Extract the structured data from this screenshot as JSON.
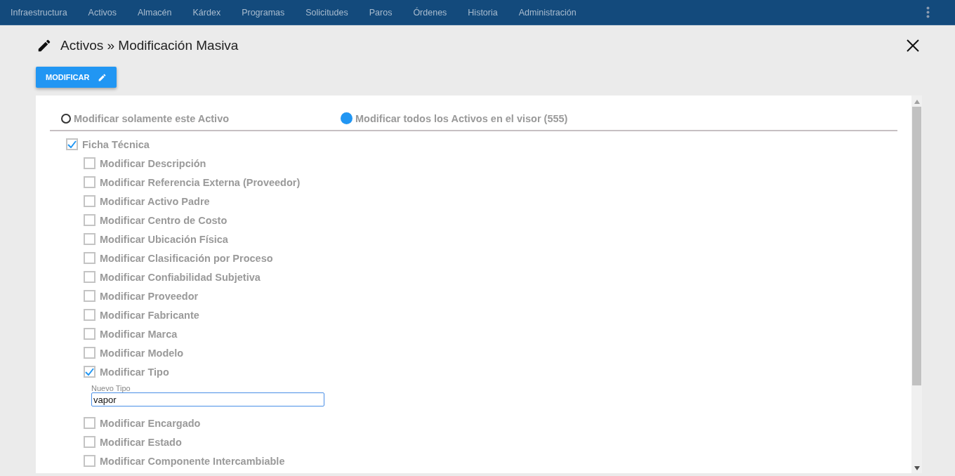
{
  "nav": {
    "items": [
      "Infraestructura",
      "Activos",
      "Almacén",
      "Kárdex",
      "Programas",
      "Solicitudes",
      "Paros",
      "Órdenes",
      "Historia",
      "Administración"
    ]
  },
  "title": "Activos » Modificación Masiva",
  "action_button": "MODIFICAR",
  "scope": [
    {
      "label": "Modificar solamente este Activo",
      "selected": false
    },
    {
      "label": "Modificar todos los Activos en el visor (555)",
      "selected": true
    }
  ],
  "section": {
    "label": "Ficha Técnica",
    "checked": true,
    "children": [
      {
        "label": "Modificar Descripción",
        "checked": false
      },
      {
        "label": "Modificar Referencia Externa (Proveedor)",
        "checked": false
      },
      {
        "label": "Modificar Activo Padre",
        "checked": false
      },
      {
        "label": "Modificar Centro de Costo",
        "checked": false
      },
      {
        "label": "Modificar Ubicación Física",
        "checked": false
      },
      {
        "label": "Modificar Clasificación por Proceso",
        "checked": false
      },
      {
        "label": "Modificar Confiabilidad Subjetiva",
        "checked": false
      },
      {
        "label": "Modificar Proveedor",
        "checked": false
      },
      {
        "label": "Modificar Fabricante",
        "checked": false
      },
      {
        "label": "Modificar Marca",
        "checked": false
      },
      {
        "label": "Modificar Modelo",
        "checked": false
      },
      {
        "label": "Modificar Tipo",
        "checked": true,
        "field": {
          "label": "Nuevo Tipo",
          "value": "vapor"
        }
      },
      {
        "label": "Modificar Encargado",
        "checked": false
      },
      {
        "label": "Modificar Estado",
        "checked": false
      },
      {
        "label": "Modificar Componente Intercambiable",
        "checked": false
      }
    ]
  }
}
